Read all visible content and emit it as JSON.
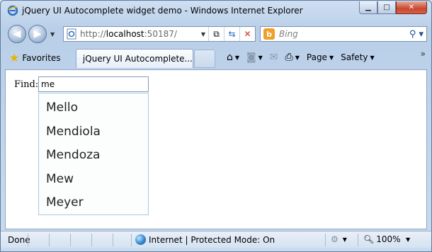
{
  "window": {
    "title": "jQuery UI Autocomplete widget demo - Windows Internet Explorer",
    "minimize_glyph": "▁",
    "maximize_glyph": "□",
    "close_glyph": "✕"
  },
  "address_bar": {
    "url_prefix": "http://",
    "url_host": "localhost",
    "url_rest": ":50187/"
  },
  "search": {
    "placeholder": "Bing",
    "provider_letter": "b"
  },
  "favorites_bar": {
    "favorites_label": "Favorites",
    "active_tab_title": "jQuery UI Autocomplete...",
    "page_label": "Page",
    "safety_label": "Safety",
    "overflow_glyph": "»"
  },
  "page": {
    "find_label": "Find:",
    "find_value": "me",
    "suggestions": [
      "Mello",
      "Mendiola",
      "Mendoza",
      "Mew",
      "Meyer"
    ]
  },
  "status_bar": {
    "status_text": "Done",
    "zone_text": "Internet | Protected Mode: On",
    "zoom_text": "100%"
  },
  "colors": {
    "menu_border": "#a6c9e2",
    "frame": "#b9cfe8"
  }
}
